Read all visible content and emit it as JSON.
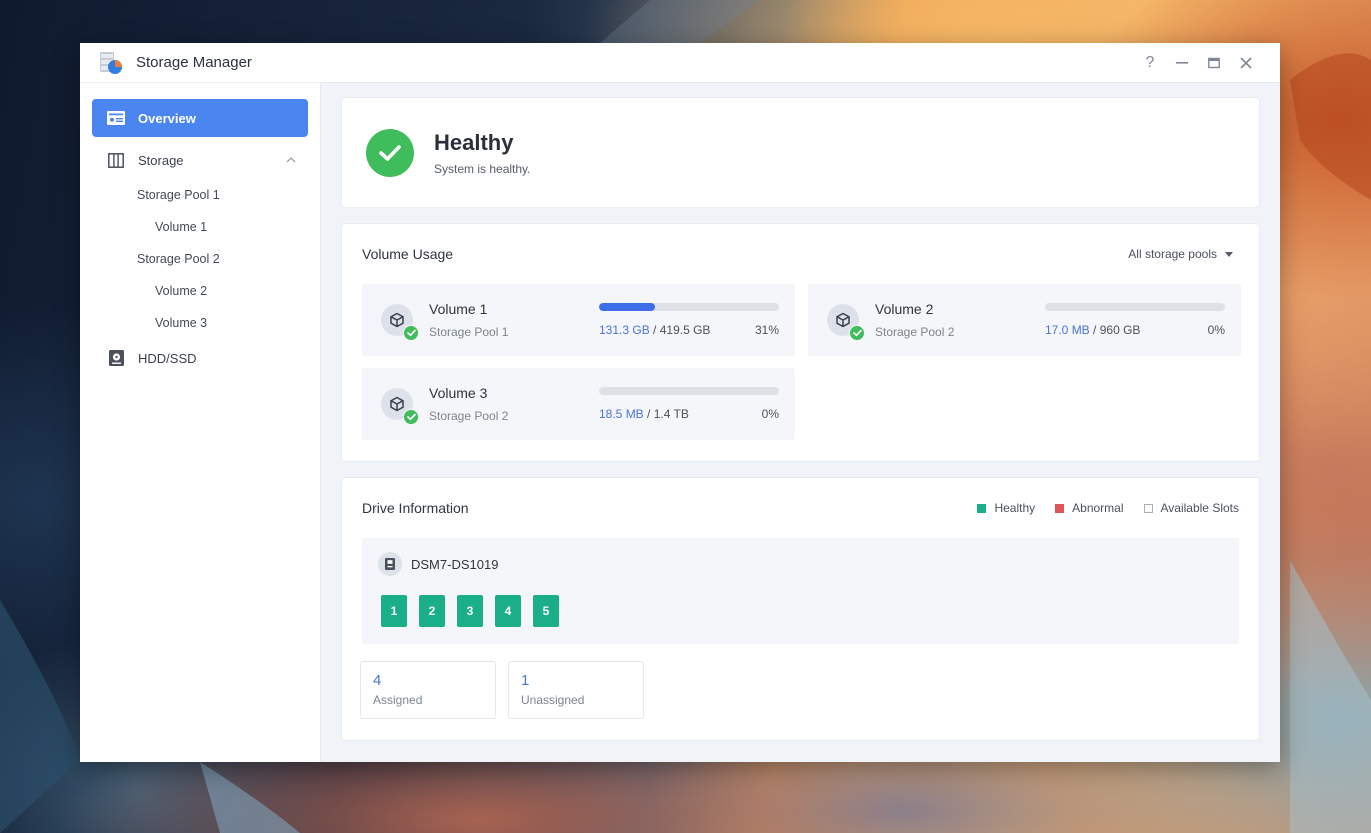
{
  "window": {
    "title": "Storage Manager",
    "controls": [
      {
        "name": "help-button",
        "glyph": "?"
      },
      {
        "name": "minimize-button",
        "glyph": "—"
      },
      {
        "name": "maximize-button",
        "glyph": "▭"
      },
      {
        "name": "close-button",
        "glyph": "✕"
      }
    ]
  },
  "sidebar": {
    "overview": "Overview",
    "storage": "Storage",
    "storage_children": [
      {
        "label": "Storage Pool 1",
        "level": 1
      },
      {
        "label": "Volume 1",
        "level": 2
      },
      {
        "label": "Storage Pool 2",
        "level": 1
      },
      {
        "label": "Volume 2",
        "level": 2
      },
      {
        "label": "Volume 3",
        "level": 2
      }
    ],
    "hdd": "HDD/SSD"
  },
  "health": {
    "title": "Healthy",
    "subtitle": "System is healthy.",
    "color": "#3fbc5c"
  },
  "volume_usage": {
    "title": "Volume Usage",
    "filter": "All storage pools",
    "volumes": [
      {
        "name": "Volume 1",
        "pool": "Storage Pool 1",
        "used": "131.3 GB",
        "total": "419.5 GB",
        "percent_label": "31%",
        "percent": 31,
        "status": "healthy"
      },
      {
        "name": "Volume 2",
        "pool": "Storage Pool 2",
        "used": "17.0 MB",
        "total": "960 GB",
        "percent_label": "0%",
        "percent": 0,
        "status": "healthy"
      },
      {
        "name": "Volume 3",
        "pool": "Storage Pool 2",
        "used": "18.5 MB",
        "total": "1.4 TB",
        "percent_label": "0%",
        "percent": 0,
        "status": "healthy"
      }
    ]
  },
  "drive_info": {
    "title": "Drive Information",
    "legend": [
      {
        "label": "Healthy",
        "color": "#1aae89",
        "kind": "filled"
      },
      {
        "label": "Abnormal",
        "color": "#e0535a",
        "kind": "filled"
      },
      {
        "label": "Available Slots",
        "color": "#a9aeb6",
        "kind": "outline"
      }
    ],
    "device": "DSM7-DS1019",
    "slots": [
      "1",
      "2",
      "3",
      "4",
      "5"
    ],
    "stats": [
      {
        "value": "4",
        "label": "Assigned"
      },
      {
        "value": "1",
        "label": "Unassigned"
      }
    ]
  },
  "colors": {
    "accent": "#4a85f0",
    "progress": "#3b6ee8",
    "healthy": "#1aae89"
  }
}
